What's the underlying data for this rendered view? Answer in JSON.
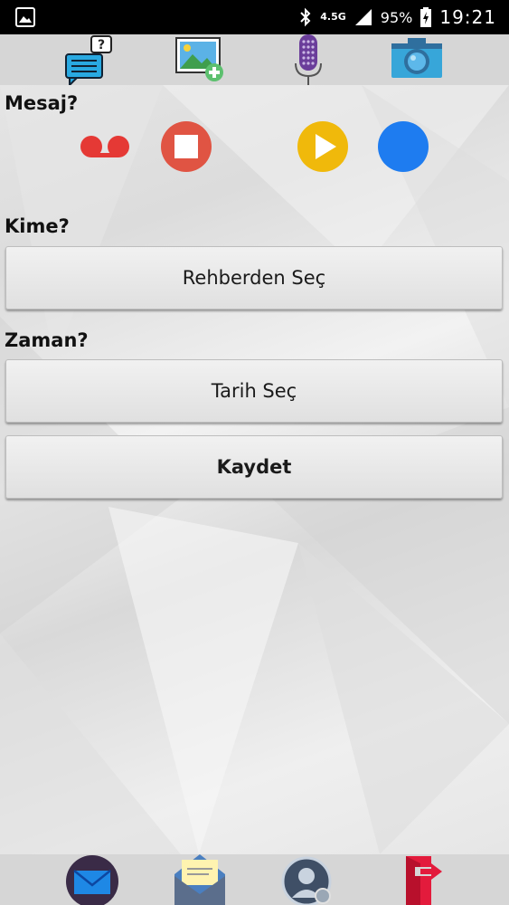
{
  "status_bar": {
    "network_type": "4.5G",
    "battery_percent": "95%",
    "time": "19:21",
    "icons": [
      "image-notification-icon",
      "bluetooth-icon",
      "signal-icon",
      "battery-charging-icon"
    ]
  },
  "toolbar": {
    "items": [
      {
        "icon": "message-question-icon"
      },
      {
        "icon": "add-image-icon"
      },
      {
        "icon": "microphone-icon"
      },
      {
        "icon": "camera-icon"
      }
    ]
  },
  "message_section": {
    "label": "Mesaj?",
    "controls": [
      {
        "icon": "voicemail-icon",
        "color": "#e53935"
      },
      {
        "icon": "stop-icon",
        "color": "#e05443"
      },
      {
        "icon": "play-icon",
        "color": "#f0b90b"
      },
      {
        "icon": "stop-icon",
        "color": "#1e7cf0"
      }
    ]
  },
  "recipient_section": {
    "label": "Kime?",
    "button_label": "Rehberden Seç"
  },
  "time_section": {
    "label": "Zaman?",
    "button_label": "Tarih Seç"
  },
  "save_button_label": "Kaydet",
  "bottom_bar": {
    "items": [
      {
        "icon": "mail-icon"
      },
      {
        "icon": "open-envelope-icon"
      },
      {
        "icon": "contact-settings-icon"
      },
      {
        "icon": "exit-icon"
      }
    ]
  },
  "colors": {
    "toolbar_bg": "#d6d6d6",
    "status_bar_bg": "#000000"
  }
}
